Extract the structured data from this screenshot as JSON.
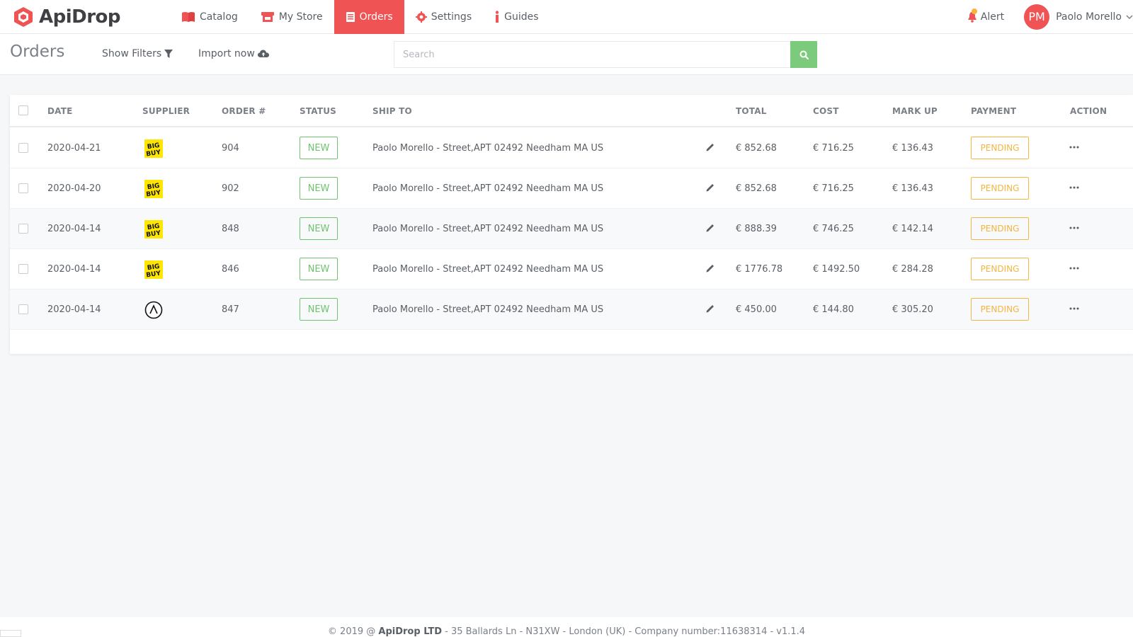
{
  "brand": {
    "name": "ApiDrop"
  },
  "nav": {
    "items": [
      {
        "label": "Catalog",
        "icon": "book-icon"
      },
      {
        "label": "My Store",
        "icon": "store-icon"
      },
      {
        "label": "Orders",
        "icon": "orders-icon",
        "active": true
      },
      {
        "label": "Settings",
        "icon": "gear-icon"
      },
      {
        "label": "Guides",
        "icon": "info-icon"
      }
    ],
    "alert_label": "Alert",
    "user": {
      "initials": "PM",
      "name": "Paolo Morello"
    }
  },
  "subheader": {
    "title": "Orders",
    "show_filters": "Show Filters",
    "import_now": "Import now",
    "search_placeholder": "Search"
  },
  "table": {
    "headers": {
      "date": "DATE",
      "supplier": "SUPPLIER",
      "order": "ORDER #",
      "status": "STATUS",
      "ship_to": "SHIP TO",
      "total": "TOTAL",
      "cost": "COST",
      "markup": "MARK UP",
      "payment": "PAYMENT",
      "action": "ACTION"
    },
    "rows": [
      {
        "date": "2020-04-21",
        "supplier": "BigBuy",
        "order": "904",
        "status": "NEW",
        "ship_to": "Paolo Morello - Street,APT 02492 Needham MA US",
        "total": "€ 852.68",
        "cost": "€ 716.25",
        "markup": "€ 136.43",
        "payment": "PENDING"
      },
      {
        "date": "2020-04-20",
        "supplier": "BigBuy",
        "order": "902",
        "status": "NEW",
        "ship_to": "Paolo Morello - Street,APT 02492 Needham MA US",
        "total": "€ 852.68",
        "cost": "€ 716.25",
        "markup": "€ 136.43",
        "payment": "PENDING"
      },
      {
        "date": "2020-04-14",
        "supplier": "BigBuy",
        "order": "848",
        "status": "NEW",
        "ship_to": "Paolo Morello - Street,APT 02492 Needham MA US",
        "total": "€ 888.39",
        "cost": "€ 746.25",
        "markup": "€ 142.14",
        "payment": "PENDING"
      },
      {
        "date": "2020-04-14",
        "supplier": "BigBuy",
        "order": "846",
        "status": "NEW",
        "ship_to": "Paolo Morello - Street,APT 02492 Needham MA US",
        "total": "€ 1776.78",
        "cost": "€ 1492.50",
        "markup": "€ 284.28",
        "payment": "PENDING"
      },
      {
        "date": "2020-04-14",
        "supplier": "circle-a",
        "order": "847",
        "status": "NEW",
        "ship_to": "Paolo Morello - Street,APT 02492 Needham MA US",
        "total": "€ 450.00",
        "cost": "€ 144.80",
        "markup": "€ 305.20",
        "payment": "PENDING"
      }
    ]
  },
  "footer": {
    "prefix": "© 2019 @ ",
    "company": "ApiDrop LTD",
    "suffix": " - 35 Ballards Ln - N31XW - London (UK) - Company number:11638314 - v1.1.4"
  },
  "colors": {
    "accent": "#f05353",
    "success": "#6fc36f",
    "warning": "#f5b53f",
    "search_button": "#7ccb7c"
  }
}
